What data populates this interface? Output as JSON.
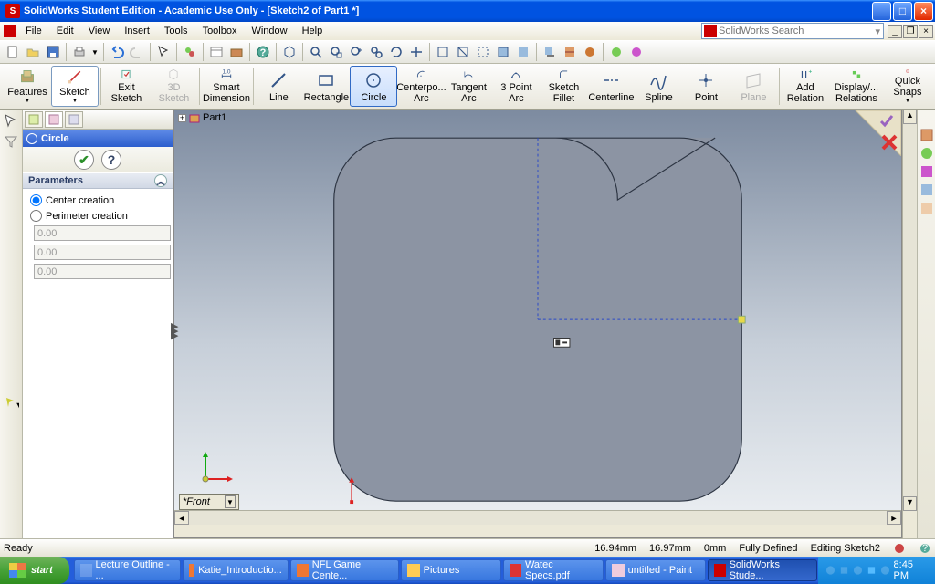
{
  "title": "SolidWorks Student Edition - Academic Use Only - [Sketch2 of Part1 *]",
  "menus": [
    "File",
    "Edit",
    "View",
    "Insert",
    "Tools",
    "Toolbox",
    "Window",
    "Help"
  ],
  "search_placeholder": "SolidWorks Search",
  "cmd": {
    "features": "Features",
    "sketch": "Sketch",
    "exit": "Exit Sketch",
    "threeD": "3D Sketch",
    "dim": "Smart Dimension",
    "line": "Line",
    "rect": "Rectangle",
    "circle": "Circle",
    "carc": "Centerpo... Arc",
    "tarc": "Tangent Arc",
    "p3arc": "3 Point Arc",
    "fillet": "Sketch Fillet",
    "cl": "Centerline",
    "spline": "Spline",
    "point": "Point",
    "plane": "Plane",
    "addrel": "Add Relation",
    "disprel": "Display/... Relations",
    "snaps": "Quick Snaps"
  },
  "pm": {
    "title": "Circle",
    "section": "Parameters",
    "opt1": "Center creation",
    "opt2": "Perimeter creation",
    "v1": "0.00",
    "v2": "0.00",
    "v3": "0.00"
  },
  "doc_label": "Part1",
  "view_name": "*Front",
  "status": {
    "ready": "Ready",
    "x": "16.94mm",
    "y": "16.97mm",
    "z": "0mm",
    "def": "Fully Defined",
    "mode": "Editing Sketch2"
  },
  "taskbar": {
    "start": "start",
    "items": [
      {
        "label": "Lecture Outline - ..."
      },
      {
        "label": "Katie_Introductio..."
      },
      {
        "label": "NFL Game Cente..."
      },
      {
        "label": "Pictures"
      },
      {
        "label": "Watec Specs.pdf"
      },
      {
        "label": "untitled - Paint"
      },
      {
        "label": "SolidWorks Stude...",
        "active": true
      }
    ],
    "time": "8:45 PM"
  },
  "chart_data": null
}
